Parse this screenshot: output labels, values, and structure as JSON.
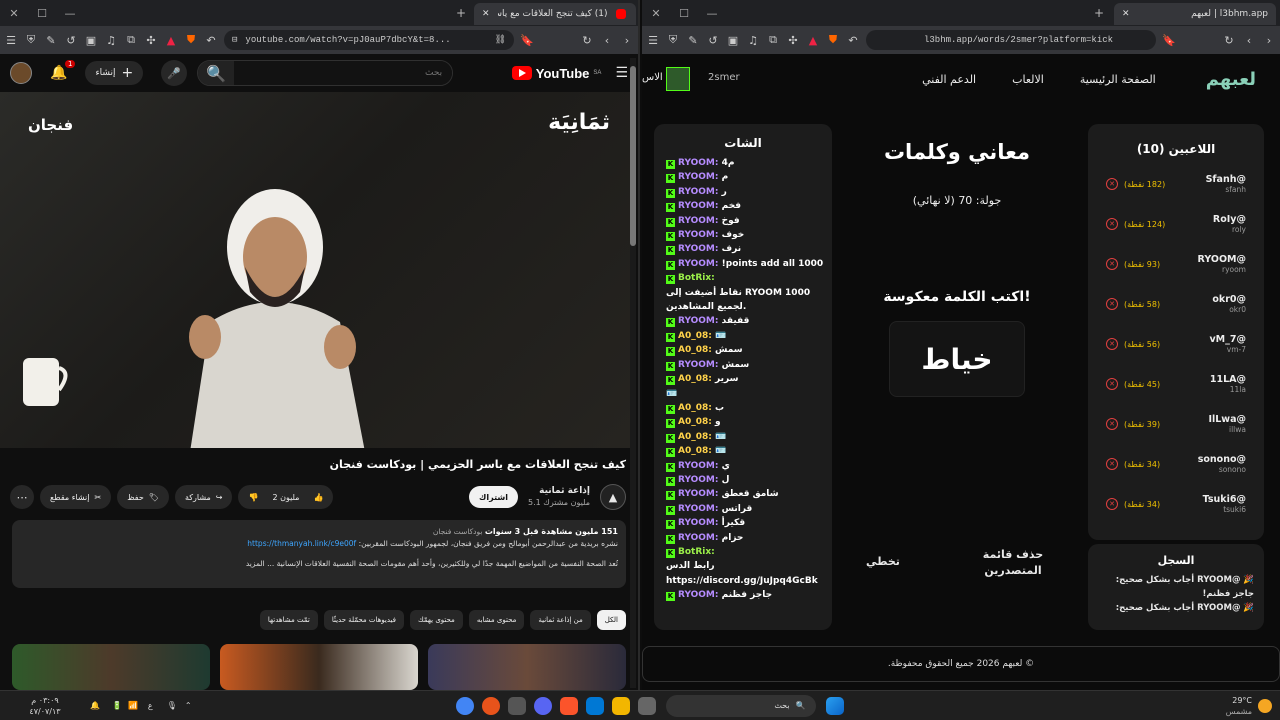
{
  "left_window": {
    "tab_title": "(1) كيف تنجح العلاقات مع ياسر ...",
    "url": "youtube.com/watch?v=pJ0auP7dbcY&t=8...",
    "notification_count": "1",
    "create_label": "إنشاء",
    "search_placeholder": "بحث",
    "logo_text": "YouTube",
    "logo_region": "SA",
    "video_brand_right": "ثمَانِيَة",
    "video_brand_left": "فنجان",
    "video_title": "كيف تنجح العلاقات مع ياسر الحزيمي | بودكاست فنجان",
    "channel_name": "إذاعة ثمانية",
    "subscribers": "5.1 مليون مشترك",
    "subscribe_label": "اشتراك",
    "like_count": "2 مليون",
    "share_label": "مشاركة",
    "save_label": "حفظ",
    "clip_label": "إنشاء مقطع",
    "desc_line1": "151 مليون مشاهدة قبل 3 سنوات",
    "desc_tag": "بودكاست فنجان",
    "desc_line2_pre": "نشره بريدية من عبدالرحمن أبومالح ومن فريق فنجان، لجمهور البودكاست المقربين:",
    "desc_link": "https://thmanyah.link/c9e00f",
    "desc_line3": "تُعد الصحة النفسية من المواضيع المهمة جدًا لي وللكثيرين، وأحد أهم مقومات الصحة النفسية العلاقات الإنسانية ... المزيد",
    "chips": [
      "الكل",
      "من إذاعة ثمانية",
      "محتوى مشابه",
      "محتوى يهمّك",
      "فيديوهات محمّلة حديثًا",
      "تمّت مشاهدتها"
    ]
  },
  "right_window": {
    "tab_title": "لعبهم | l3bhm.app",
    "url": "l3bhm.app/words/2smer?platform=kick",
    "nav": {
      "logo": "لعبهم",
      "home": "الصفحة الرئيسية",
      "games": "الالعاب",
      "support": "الدعم الفني",
      "partial": "الاس",
      "username": "2smer"
    },
    "players_card": {
      "title": "اللاعبين (10)",
      "players": [
        {
          "name": "@Sfanh",
          "user": "sfanh",
          "points": "(182 نقطة)"
        },
        {
          "name": "@RoIy",
          "user": "roly",
          "points": "(124 نقطة)"
        },
        {
          "name": "@RYOOM",
          "user": "ryoom",
          "points": "(93 نقطة)"
        },
        {
          "name": "@okr0",
          "user": "okr0",
          "points": "(58 نقطة)"
        },
        {
          "name": "@vM_7",
          "user": "vm-7",
          "points": "(56 نقطة)"
        },
        {
          "name": "@11LA",
          "user": "11la",
          "points": "(45 نقطة)"
        },
        {
          "name": "@IlLwa",
          "user": "illwa",
          "points": "(39 نقطة)"
        },
        {
          "name": "@sonono",
          "user": "sonono",
          "points": "(34 نقطة)"
        },
        {
          "name": "@Tsuki6",
          "user": "tsuki6",
          "points": "(34 نقطة)"
        }
      ]
    },
    "log_card": {
      "title": "السجل",
      "line1": "🎉 @RYOOM أجاب بشكل صحيح:",
      "line2": "جاجز فظنم!",
      "line3": "🎉 @RYOOM أجاب بشكل صحيح:"
    },
    "game": {
      "title": "معاني وكلمات",
      "round": "جولة: 70 (لا نهائي)",
      "prompt": "اكتب الكلمة معكوسة!",
      "word": "خياط",
      "skip": "تخطي",
      "delete_board": "حذف قائمة المتصدرين"
    },
    "chat": {
      "title": "الشات",
      "lines": [
        {
          "u": "RYOOM:",
          "t": "4م",
          "c": "u1"
        },
        {
          "u": "RYOOM:",
          "t": "م",
          "c": "u1"
        },
        {
          "u": "RYOOM:",
          "t": "ر",
          "c": "u1"
        },
        {
          "u": "RYOOM:",
          "t": "فخم",
          "c": "u1"
        },
        {
          "u": "RYOOM:",
          "t": "فوخ",
          "c": "u1"
        },
        {
          "u": "RYOOM:",
          "t": "خوف",
          "c": "u1"
        },
        {
          "u": "RYOOM:",
          "t": "نرف",
          "c": "u1"
        },
        {
          "u": "RYOOM:",
          "t": "!points add all 1000",
          "c": "u1"
        },
        {
          "u": "BotRix:",
          "t": "",
          "c": "u3"
        },
        {
          "u": "",
          "t": "نقاط أضيفت إلى RYOOM 1000",
          "c": ""
        },
        {
          "u": "",
          "t": "لجميع المشاهدين.",
          "c": ""
        },
        {
          "u": "RYOOM:",
          "t": "قفيقد",
          "c": "u1"
        },
        {
          "u": "A0_08:",
          "t": "🪪",
          "c": "u2"
        },
        {
          "u": "A0_08:",
          "t": "سمش",
          "c": "u2"
        },
        {
          "u": "RYOOM:",
          "t": "سمش",
          "c": "u1"
        },
        {
          "u": "A0_08:",
          "t": "سرير",
          "c": "u2"
        },
        {
          "u": "",
          "t": "🪪",
          "c": "u2"
        },
        {
          "u": "A0_08:",
          "t": "ب",
          "c": "u2"
        },
        {
          "u": "A0_08:",
          "t": "و",
          "c": "u2"
        },
        {
          "u": "A0_08:",
          "t": "🪪",
          "c": "u2"
        },
        {
          "u": "A0_08:",
          "t": "🪪",
          "c": "u2"
        },
        {
          "u": "RYOOM:",
          "t": "ي",
          "c": "u1"
        },
        {
          "u": "RYOOM:",
          "t": "ل",
          "c": "u1"
        },
        {
          "u": "RYOOM:",
          "t": "شامق قعطق",
          "c": "u1"
        },
        {
          "u": "RYOOM:",
          "t": "قراتس",
          "c": "u1"
        },
        {
          "u": "RYOOM:",
          "t": "قكيرأ",
          "c": "u1"
        },
        {
          "u": "RYOOM:",
          "t": "حزام",
          "c": "u1"
        },
        {
          "u": "BotRix:",
          "t": "",
          "c": "u3"
        },
        {
          "u": "",
          "t": "رابط الدس",
          "c": ""
        },
        {
          "u": "",
          "t": "https://discord.gg/JuJpq4GcBk",
          "c": ""
        },
        {
          "u": "RYOOM:",
          "t": "جاجز فظنم",
          "c": "u1"
        }
      ]
    },
    "footer": "© لعبهم 2026 جميع الحقوق محفوظة."
  },
  "taskbar": {
    "weather_temp": "29°C",
    "weather_desc": "مشمس",
    "search_placeholder": "بحث",
    "time": "٠٣:٠٩ م",
    "date": "٤٧/٠٧/١٣",
    "lang": "ع"
  },
  "colors": {
    "kick_green": "#53fc18",
    "yt_red": "#ff0000",
    "points_yellow": "#f0c000",
    "logo_teal": "#8ad0b8"
  }
}
